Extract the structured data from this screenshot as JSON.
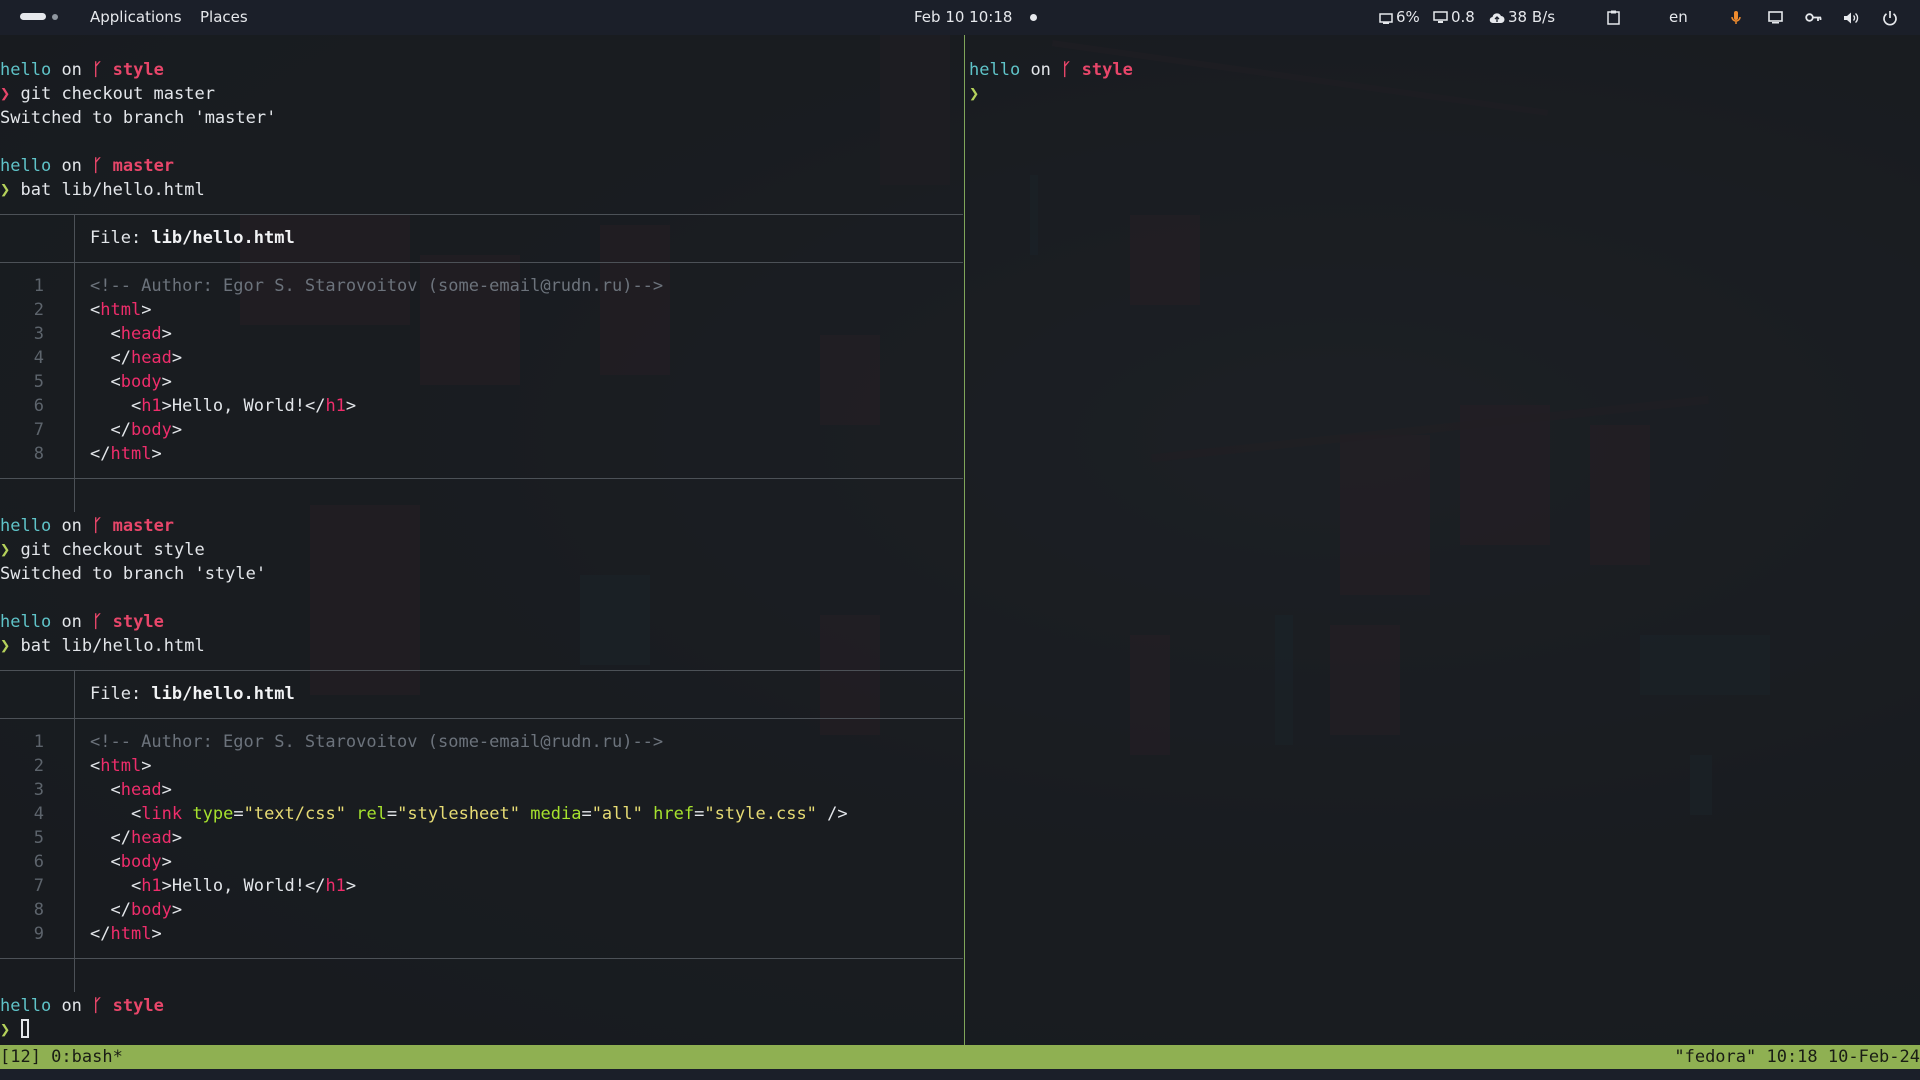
{
  "topbar": {
    "applications_label": "Applications",
    "places_label": "Places",
    "clock": "Feb 10  10:18",
    "cpu": "6%",
    "load": "0.8",
    "net": "38 B/s",
    "keyboard_layout": "en",
    "mic_color": "#f08c2e"
  },
  "left_pane": {
    "blocks": [
      {
        "dir": "hello",
        "on": "on",
        "branch_glyph": "ᚴ",
        "branch": "style",
        "cmd": "git checkout master"
      },
      {
        "output": "Switched to branch 'master'"
      },
      {
        "dir": "hello",
        "on": "on",
        "branch_glyph": "ᚴ",
        "branch": "master",
        "cmd": "bat lib/hello.html"
      }
    ],
    "bat1": {
      "file_prefix": "File: ",
      "file_name": "lib/hello.html",
      "lines": [
        {
          "n": "1",
          "text": "<!-- Author: Egor S. Starovoitov (some-email@rudn.ru)-->"
        },
        {
          "n": "2",
          "text": "<html>"
        },
        {
          "n": "3",
          "text": "  <head>"
        },
        {
          "n": "4",
          "text": "  </head>"
        },
        {
          "n": "5",
          "text": "  <body>"
        },
        {
          "n": "6",
          "text": "    <h1>Hello, World!</h1>"
        },
        {
          "n": "7",
          "text": "  </body>"
        },
        {
          "n": "8",
          "text": "</html>"
        }
      ]
    },
    "blocks2": [
      {
        "dir": "hello",
        "on": "on",
        "branch_glyph": "ᚴ",
        "branch": "master",
        "cmd": "git checkout style"
      },
      {
        "output": "Switched to branch 'style'"
      },
      {
        "dir": "hello",
        "on": "on",
        "branch_glyph": "ᚴ",
        "branch": "style",
        "cmd": "bat lib/hello.html"
      }
    ],
    "bat2": {
      "file_prefix": "File: ",
      "file_name": "lib/hello.html",
      "lines": [
        {
          "n": "1",
          "text": "<!-- Author: Egor S. Starovoitov (some-email@rudn.ru)-->"
        },
        {
          "n": "2",
          "text": "<html>"
        },
        {
          "n": "3",
          "text": "  <head>"
        },
        {
          "n": "4",
          "text": "    <link type=\"text/css\" rel=\"stylesheet\" media=\"all\" href=\"style.css\" />"
        },
        {
          "n": "5",
          "text": "  </head>"
        },
        {
          "n": "6",
          "text": "  <body>"
        },
        {
          "n": "7",
          "text": "    <h1>Hello, World!</h1>"
        },
        {
          "n": "8",
          "text": "  </body>"
        },
        {
          "n": "9",
          "text": "</html>"
        }
      ]
    },
    "final_prompt": {
      "dir": "hello",
      "on": "on",
      "branch_glyph": "ᚴ",
      "branch": "style"
    },
    "prompt_char": "❯"
  },
  "right_pane": {
    "prompt": {
      "dir": "hello",
      "on": "on",
      "branch_glyph": "ᚴ",
      "branch": "style"
    },
    "prompt_char": "❯"
  },
  "tmux": {
    "left": "[12] 0:bash*",
    "right": "\"fedora\" 10:18 10-Feb-24"
  },
  "colors": {
    "accent_green": "#8fb052",
    "branch_red": "#e8466a",
    "dir_cyan": "#5fc3c8"
  }
}
